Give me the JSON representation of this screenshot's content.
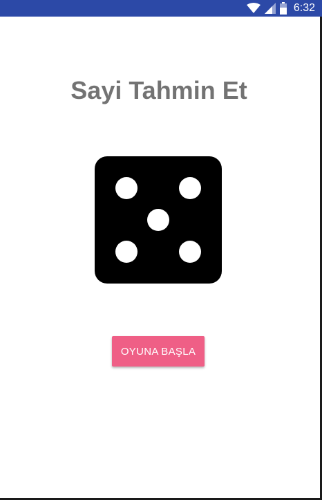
{
  "status_bar": {
    "time": "6:32",
    "icons": [
      "wifi-icon",
      "signal-icon",
      "battery-icon"
    ],
    "color": "#2c49a7"
  },
  "main": {
    "title": "Sayi Tahmin Et",
    "dice": {
      "icon": "dice-five-icon",
      "face_value": 5
    },
    "start_button": {
      "label": "OYUNA BAŞLA",
      "color": "#ef5f86"
    }
  }
}
